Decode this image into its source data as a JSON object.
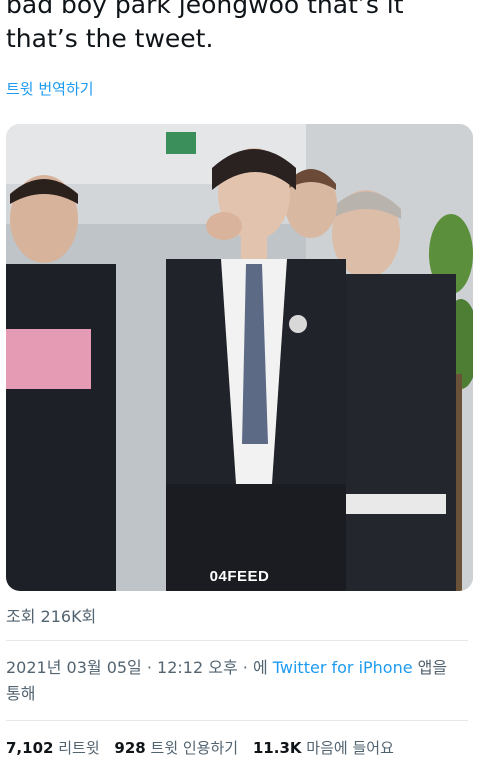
{
  "tweet": {
    "text": "bad boy park jeongwoo that’s it that’s the tweet.",
    "translate_label": "트윗 번역하기"
  },
  "media": {
    "watermark": "04FEED"
  },
  "views": {
    "label": "조회 216K회"
  },
  "meta": {
    "date": "2021년 03월 05일",
    "separator1": " · ",
    "time": "12:12 오후",
    "separator2": " · ",
    "via_prefix": "에 ",
    "source": "Twitter for iPhone",
    "via_suffix": " 앱을 통해"
  },
  "stats": {
    "retweets_count": "7,102",
    "retweets_label": "리트윗",
    "quotes_count": "928",
    "quotes_label": "트윗 인용하기",
    "likes_count": "11.3K",
    "likes_label": "마음에 들어요"
  },
  "colors": {
    "link": "#1d9bf0",
    "secondary_text": "#536471",
    "primary_text": "#0f1419"
  }
}
